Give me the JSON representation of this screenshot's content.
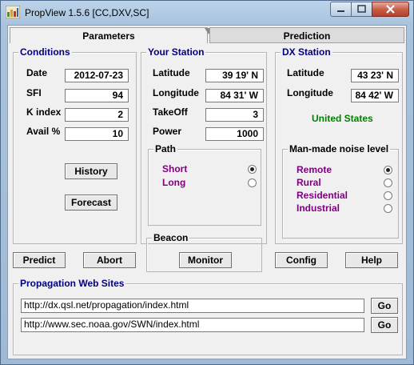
{
  "window": {
    "title": "PropView 1.5.6  [CC,DXV,SC]"
  },
  "tabs": {
    "parameters": "Parameters",
    "prediction": "Prediction"
  },
  "conditions": {
    "title": "Conditions",
    "date_label": "Date",
    "date_value": "2012-07-23",
    "sfi_label": "SFI",
    "sfi_value": "94",
    "kindex_label": "K index",
    "kindex_value": "2",
    "avail_label": "Avail %",
    "avail_value": "10",
    "history_button": "History",
    "forecast_button": "Forecast"
  },
  "your_station": {
    "title": "Your Station",
    "latitude_label": "Latitude",
    "latitude_value": "39  19' N",
    "longitude_label": "Longitude",
    "longitude_value": "84  31' W",
    "takeoff_label": "TakeOff",
    "takeoff_value": "3",
    "power_label": "Power",
    "power_value": "1000",
    "path": {
      "title": "Path",
      "short": "Short",
      "long": "Long",
      "selected": "Short"
    }
  },
  "dx_station": {
    "title": "DX Station",
    "latitude_label": "Latitude",
    "latitude_value": "43  23' N",
    "longitude_label": "Longitude",
    "longitude_value": "84  42' W",
    "country": "United States",
    "noise": {
      "title": "Man-made noise level",
      "options": [
        "Remote",
        "Rural",
        "Residential",
        "Industrial"
      ],
      "selected": "Remote"
    }
  },
  "beacon": {
    "title": "Beacon",
    "monitor_button": "Monitor"
  },
  "actions": {
    "predict": "Predict",
    "abort": "Abort",
    "config": "Config",
    "help": "Help"
  },
  "web_sites": {
    "title": "Propagation Web Sites",
    "urls": [
      "http://dx.qsl.net/propagation/index.html",
      "http://www.sec.noaa.gov/SWN/index.html"
    ],
    "go_label": "Go"
  },
  "colors": {
    "accent_title": "#000080",
    "option_text": "#800080",
    "country_text": "#008000"
  }
}
